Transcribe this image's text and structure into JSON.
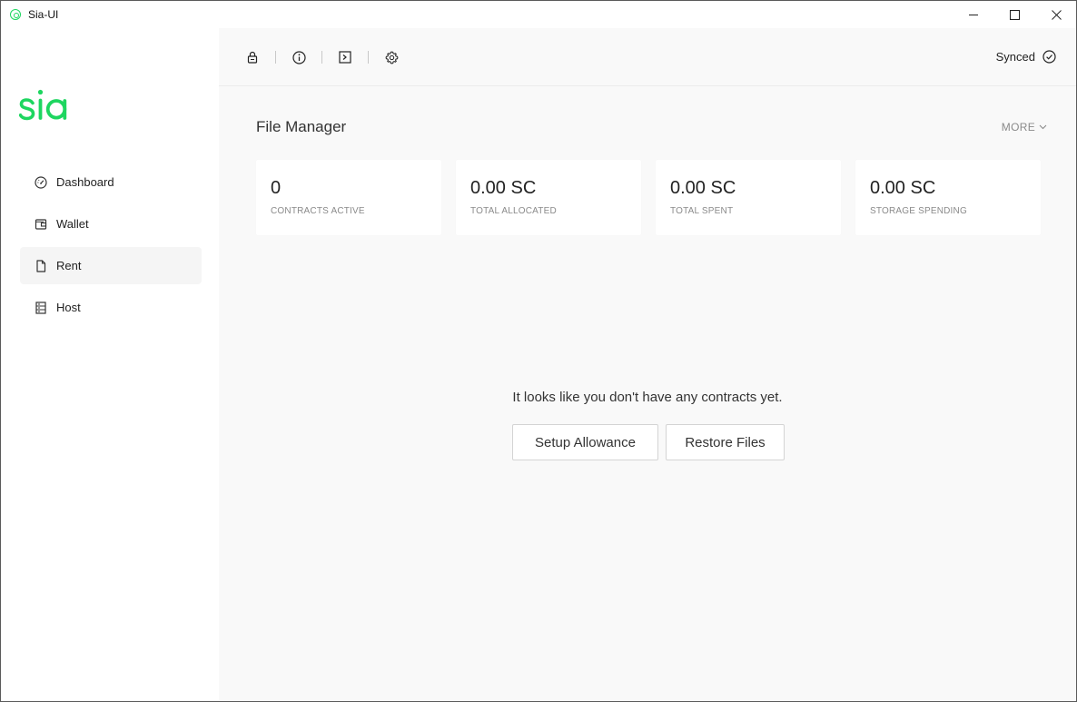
{
  "window": {
    "title": "Sia-UI",
    "controls": [
      "minimize-icon",
      "maximize-icon",
      "close-icon"
    ]
  },
  "brand": {
    "logo_text": "sia",
    "color": "#1ed660"
  },
  "sidebar": {
    "items": [
      {
        "label": "Dashboard",
        "icon": "dashboard-gauge-icon"
      },
      {
        "label": "Wallet",
        "icon": "wallet-icon"
      },
      {
        "label": "Rent",
        "icon": "file-icon",
        "active": true
      },
      {
        "label": "Host",
        "icon": "host-server-icon"
      }
    ]
  },
  "toolbar": {
    "icons": [
      "lock-icon",
      "info-icon",
      "terminal-icon",
      "settings-gear-icon"
    ],
    "status": "Synced",
    "status_icon": "check-circle-icon"
  },
  "page": {
    "title": "File Manager",
    "more_label": "MORE"
  },
  "stats": [
    {
      "value": "0",
      "label": "CONTRACTS ACTIVE"
    },
    {
      "value": "0.00 SC",
      "label": "TOTAL ALLOCATED"
    },
    {
      "value": "0.00 SC",
      "label": "TOTAL SPENT"
    },
    {
      "value": "0.00 SC",
      "label": "STORAGE SPENDING"
    }
  ],
  "empty_state": {
    "message": "It looks like you don't have any contracts yet.",
    "setup_label": "Setup Allowance",
    "restore_label": "Restore Files"
  }
}
